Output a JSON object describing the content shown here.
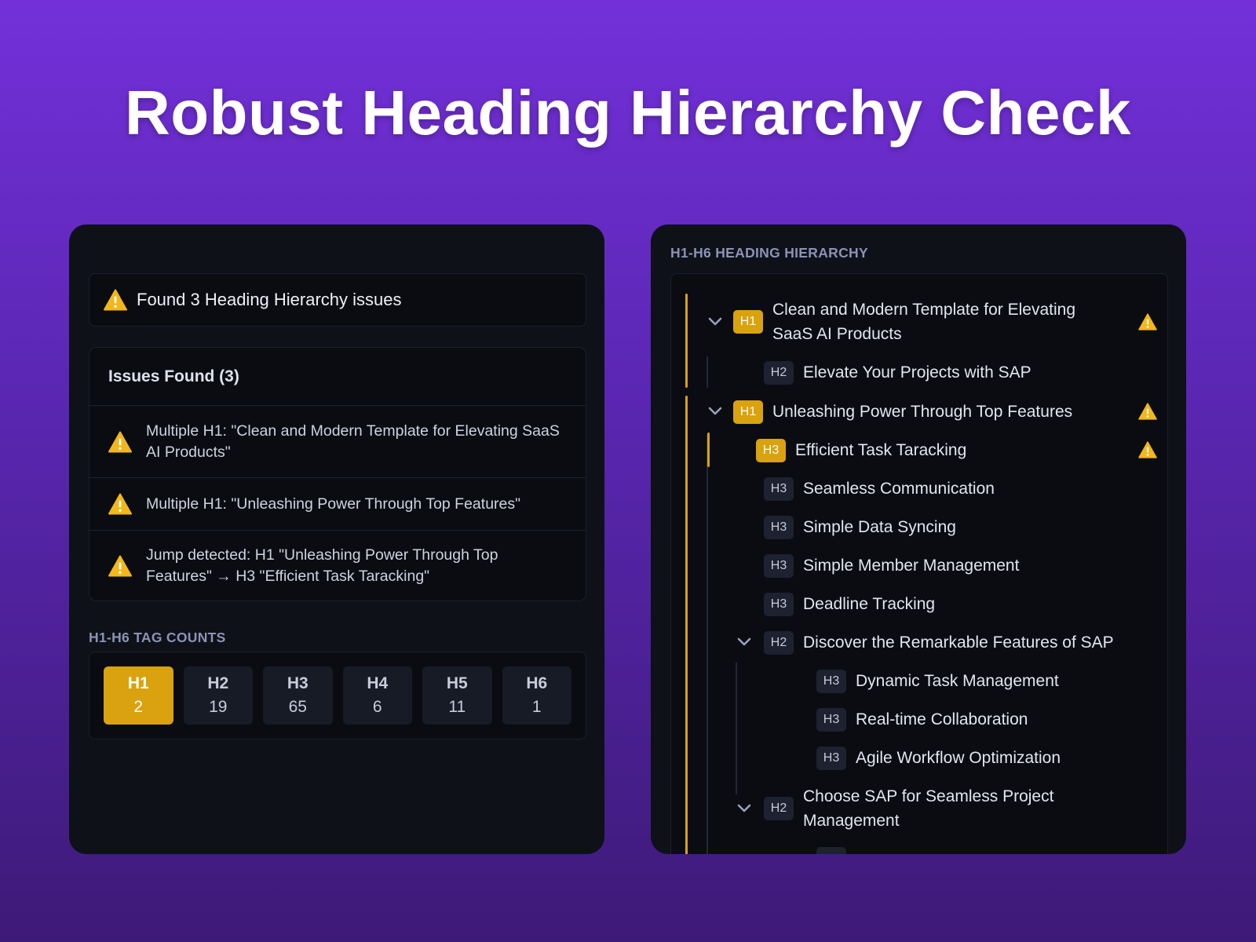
{
  "title": "Robust Heading Hierarchy Check",
  "left": {
    "alert": "Found 3 Heading Hierarchy issues",
    "issues_title": "Issues Found (3)",
    "issues": [
      "Multiple H1: \"Clean and Modern Template for Elevating SaaS AI Products\"",
      "Multiple H1: \"Unleashing Power Through Top Features\"",
      "Jump detected: H1 \"Unleashing Power Through Top Features\" → H3 \"Efficient Task Taracking\""
    ],
    "counts_label": "H1-H6 TAG COUNTS",
    "counts": [
      {
        "tag": "H1",
        "value": "2",
        "active": true
      },
      {
        "tag": "H2",
        "value": "19"
      },
      {
        "tag": "H3",
        "value": "65"
      },
      {
        "tag": "H4",
        "value": "6"
      },
      {
        "tag": "H5",
        "value": "11"
      },
      {
        "tag": "H6",
        "value": "1"
      }
    ]
  },
  "right": {
    "label": "H1-H6 HEADING HIERARCHY",
    "items": [
      {
        "tag": "H1",
        "text": "Clean and Modern Template for Elevating SaaS AI Products",
        "warning": true,
        "collapsible": true
      },
      {
        "tag": "H2",
        "text": "Elevate Your Projects with SAP"
      },
      {
        "tag": "H1",
        "text": "Unleashing Power Through Top Features",
        "warning": true,
        "collapsible": true
      },
      {
        "tag": "H3",
        "text": "Efficient Task Taracking",
        "warning": true
      },
      {
        "tag": "H3",
        "text": "Seamless Communication"
      },
      {
        "tag": "H3",
        "text": "Simple Data Syncing"
      },
      {
        "tag": "H3",
        "text": "Simple Member Management"
      },
      {
        "tag": "H3",
        "text": "Deadline Tracking"
      },
      {
        "tag": "H2",
        "text": "Discover the Remarkable Features of SAP",
        "collapsible": true
      },
      {
        "tag": "H3",
        "text": "Dynamic Task Management"
      },
      {
        "tag": "H3",
        "text": "Real-time Collaboration"
      },
      {
        "tag": "H3",
        "text": "Agile Workflow Optimization"
      },
      {
        "tag": "H2",
        "text": "Choose SAP for Seamless Project Management",
        "collapsible": true
      }
    ]
  },
  "colors": {
    "accent": "#d9a20e",
    "warning": "#f2c21b",
    "panel": "#0e1118"
  }
}
